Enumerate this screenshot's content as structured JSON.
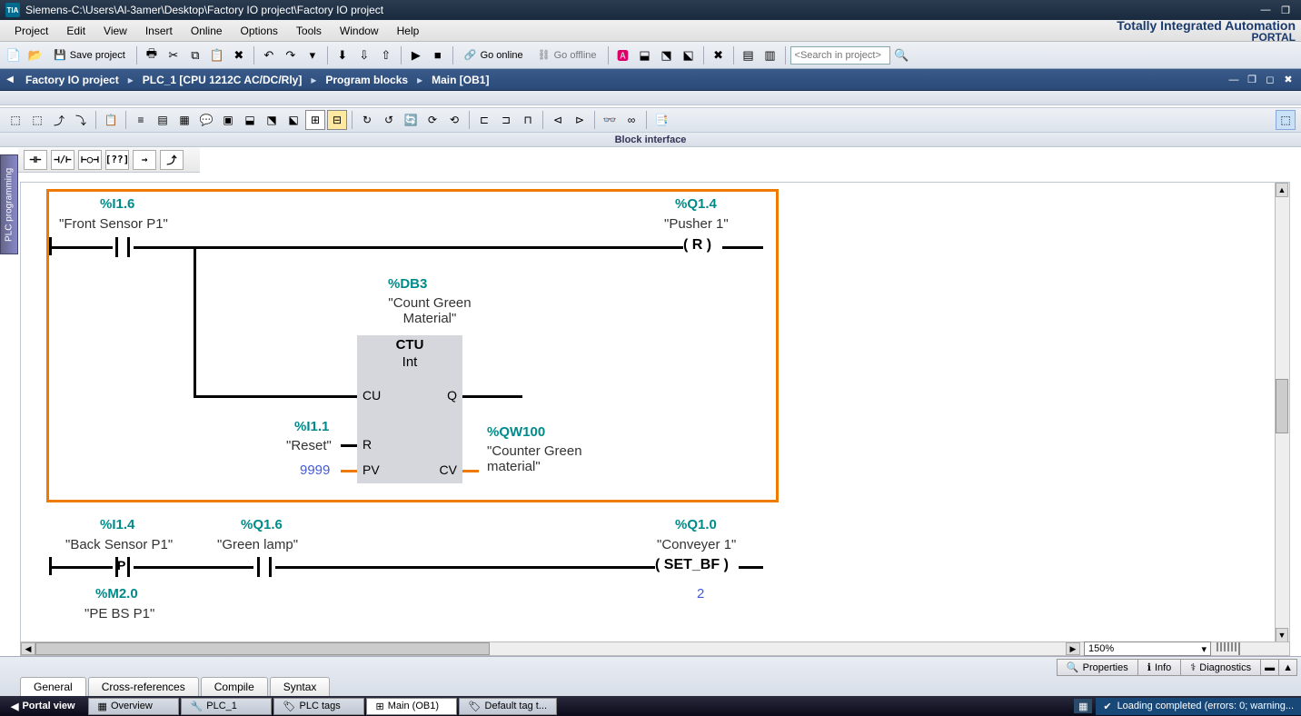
{
  "title": {
    "app": "Siemens",
    "sep": " - ",
    "path": "C:\\Users\\Al-3amer\\Desktop\\Factory IO project\\Factory IO project"
  },
  "menu": [
    "Project",
    "Edit",
    "View",
    "Insert",
    "Online",
    "Options",
    "Tools",
    "Window",
    "Help"
  ],
  "brand": {
    "line1": "Totally Integrated Automation",
    "line2": "PORTAL"
  },
  "toolbar": {
    "save": "Save project",
    "go_online": "Go online",
    "go_offline": "Go offline",
    "search_ph": "<Search in project>"
  },
  "breadcrumb": [
    "Factory IO project",
    "PLC_1 [CPU 1212C AC/DC/Rly]",
    "Program blocks",
    "Main [OB1]"
  ],
  "block_interface": "Block interface",
  "sidetab": "PLC programming",
  "instructions": [
    "⊣ ⊢",
    "⊣/⊢",
    "⊢○⊣",
    "??",
    "→",
    "⤴"
  ],
  "ladder": {
    "net1": {
      "highlighted": true,
      "contact1": {
        "addr": "%I1.6",
        "name": "\"Front Sensor P1\""
      },
      "coil1": {
        "addr": "%Q1.4",
        "name": "\"Pusher 1\"",
        "type": "R"
      },
      "block": {
        "db_addr": "%DB3",
        "db_name": "\"Count Green Material\"",
        "type": "CTU",
        "dtype": "Int",
        "ports": {
          "CU": "CU",
          "R": "R",
          "PV": "PV",
          "Q": "Q",
          "CV": "CV"
        }
      },
      "reset": {
        "addr": "%I1.1",
        "name": "\"Reset\""
      },
      "pv": "9999",
      "cv_out": {
        "addr": "%QW100",
        "name": "\"Counter Green material\""
      }
    },
    "net2": {
      "contact1": {
        "addr": "%I1.4",
        "name": "\"Back Sensor P1\"",
        "edge": "P"
      },
      "edge_mem": {
        "addr": "%M2.0",
        "name": "\"PE BS P1\""
      },
      "contact2": {
        "addr": "%Q1.6",
        "name": "\"Green lamp\""
      },
      "coil": {
        "addr": "%Q1.0",
        "name": "\"Conveyer 1\"",
        "type": "SET_BF"
      },
      "count": "2"
    }
  },
  "zoom": "150%",
  "footer": {
    "buttons": [
      {
        "icon": "🔍",
        "label": "Properties"
      },
      {
        "icon": "ℹ",
        "label": "Info"
      },
      {
        "icon": "⚕",
        "label": "Diagnostics"
      }
    ],
    "tabs": [
      "General",
      "Cross-references",
      "Compile",
      "Syntax"
    ]
  },
  "taskbar": {
    "portal": "Portal view",
    "items": [
      {
        "label": "Overview",
        "active": false
      },
      {
        "label": "PLC_1",
        "active": false
      },
      {
        "label": "PLC tags",
        "active": false
      },
      {
        "label": "Main (OB1)",
        "active": true
      },
      {
        "label": "Default tag t...",
        "active": false
      }
    ],
    "status": "Loading completed (errors: 0; warning..."
  }
}
